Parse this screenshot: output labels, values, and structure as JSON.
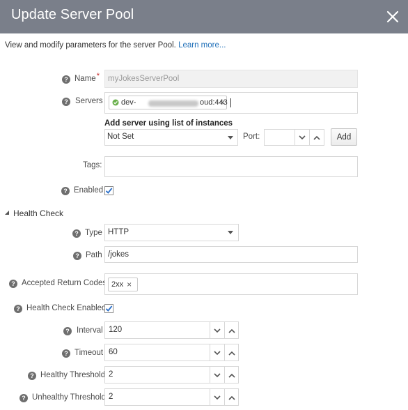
{
  "dialog": {
    "title": "Update Server Pool",
    "intro_text": "View and modify parameters for the server Pool.",
    "learn_more": "Learn more..."
  },
  "form": {
    "name": {
      "label": "Name",
      "required_mark": "*",
      "value": "myJokesServerPool"
    },
    "servers": {
      "label": "Servers",
      "chip_prefix": "dev-",
      "chip_suffix": "oud:443",
      "chip_status_color": "#6ab04c"
    },
    "add_server": {
      "heading": "Add server using list of instances",
      "instance_value": "Not Set",
      "port_label": "Port:",
      "port_value": "",
      "add_label": "Add"
    },
    "tags": {
      "label": "Tags:",
      "value": ""
    },
    "enabled": {
      "label": "Enabled",
      "checked": true
    },
    "health_check": {
      "section_label": "Health Check",
      "type": {
        "label": "Type",
        "value": "HTTP"
      },
      "path": {
        "label": "Path",
        "value": "/jokes"
      },
      "accepted_codes": {
        "label": "Accepted Return Codes",
        "chip": "2xx"
      },
      "hc_enabled": {
        "label": "Health Check Enabled",
        "checked": true
      },
      "interval": {
        "label": "Interval",
        "value": "120"
      },
      "timeout": {
        "label": "Timeout",
        "value": "60"
      },
      "healthy_threshold": {
        "label": "Healthy Threshold",
        "value": "2"
      },
      "unhealthy_threshold": {
        "label": "Unhealthy Threshold",
        "value": "2"
      }
    }
  },
  "icons": {
    "help": "?",
    "close": "close-icon",
    "chip_remove": "×",
    "check": "check-icon"
  },
  "colors": {
    "titlebar": "#7a7f8a",
    "link": "#1f6fb8",
    "required": "#c21e1e",
    "check": "#2a6fc9"
  }
}
